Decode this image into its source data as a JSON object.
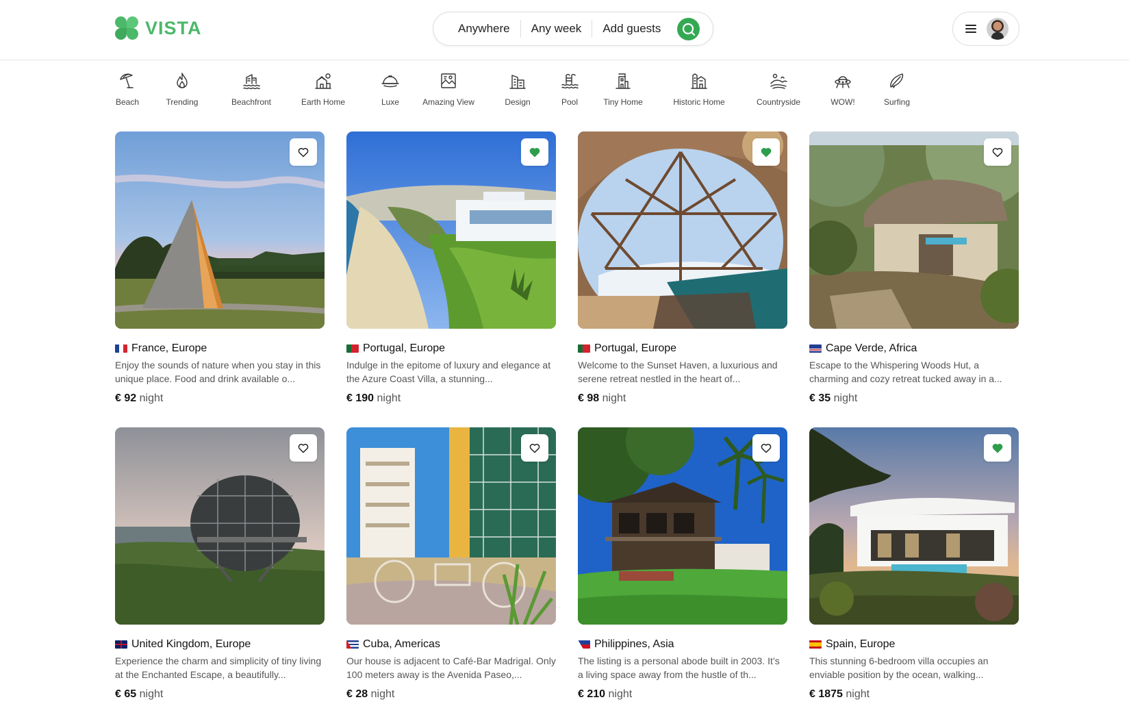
{
  "brand": {
    "name": "VISTA",
    "color": "#4cb86a"
  },
  "search": {
    "where": "Anywhere",
    "when": "Any week",
    "who": "Add guests",
    "icon": "search-icon"
  },
  "user_menu": {
    "menu_icon": "hamburger-icon",
    "avatar": "avatar"
  },
  "categories": [
    {
      "label": "Beach",
      "icon": "umbrella-icon"
    },
    {
      "label": "Trending",
      "icon": "flame-icon"
    },
    {
      "label": "Beachfront",
      "icon": "beachfront-icon"
    },
    {
      "label": "Earth Home",
      "icon": "earth-home-icon"
    },
    {
      "label": "Luxe",
      "icon": "cloche-icon"
    },
    {
      "label": "Amazing View",
      "icon": "landscape-frame-icon"
    },
    {
      "label": "Design",
      "icon": "building-icon"
    },
    {
      "label": "Pool",
      "icon": "pool-icon"
    },
    {
      "label": "Tiny Home",
      "icon": "tiny-home-icon"
    },
    {
      "label": "Historic Home",
      "icon": "historic-home-icon"
    },
    {
      "label": "Countryside",
      "icon": "countryside-icon"
    },
    {
      "label": "WOW!",
      "icon": "ufo-icon"
    },
    {
      "label": "Surfing",
      "icon": "surfboard-icon"
    }
  ],
  "currency": "€",
  "per_label": "night",
  "listings": [
    {
      "location": "France, Europe",
      "flag": "fr",
      "description": "Enjoy the sounds of nature when you stay in this unique place. Food and drink available o...",
      "price": "92",
      "favorited": false
    },
    {
      "location": "Portugal, Europe",
      "flag": "pt",
      "description": "Indulge in the epitome of luxury and elegance at the Azure Coast Villa, a stunning...",
      "price": "190",
      "favorited": true
    },
    {
      "location": "Portugal, Europe",
      "flag": "pt",
      "description": "Welcome to the Sunset Haven, a luxurious and serene retreat nestled in the heart of...",
      "price": "98",
      "favorited": true
    },
    {
      "location": "Cape Verde, Africa",
      "flag": "cv",
      "description": "Escape to the Whispering Woods Hut, a charming and cozy retreat tucked away in a...",
      "price": "35",
      "favorited": false
    },
    {
      "location": "United Kingdom, Europe",
      "flag": "gb",
      "description": "Experience the charm and simplicity of tiny living at the Enchanted Escape, a beautifully...",
      "price": "65",
      "favorited": false
    },
    {
      "location": "Cuba, Americas",
      "flag": "cu",
      "description": "Our house is adjacent to Café-Bar Madrigal. Only 100 meters away is the Avenida Paseo,...",
      "price": "28",
      "favorited": false
    },
    {
      "location": "Philippines, Asia",
      "flag": "ph",
      "description": "The listing is a personal abode built in 2003. It’s a living space away from the hustle of th...",
      "price": "210",
      "favorited": false
    },
    {
      "location": "Spain, Europe",
      "flag": "es",
      "description": "This stunning 6-bedroom villa occupies an enviable position by the ocean, walking...",
      "price": "1875",
      "favorited": true
    }
  ],
  "colors": {
    "accent": "#35a853",
    "heart_filled": "#2e9e4c",
    "text": "#222222",
    "muted": "#555555"
  }
}
